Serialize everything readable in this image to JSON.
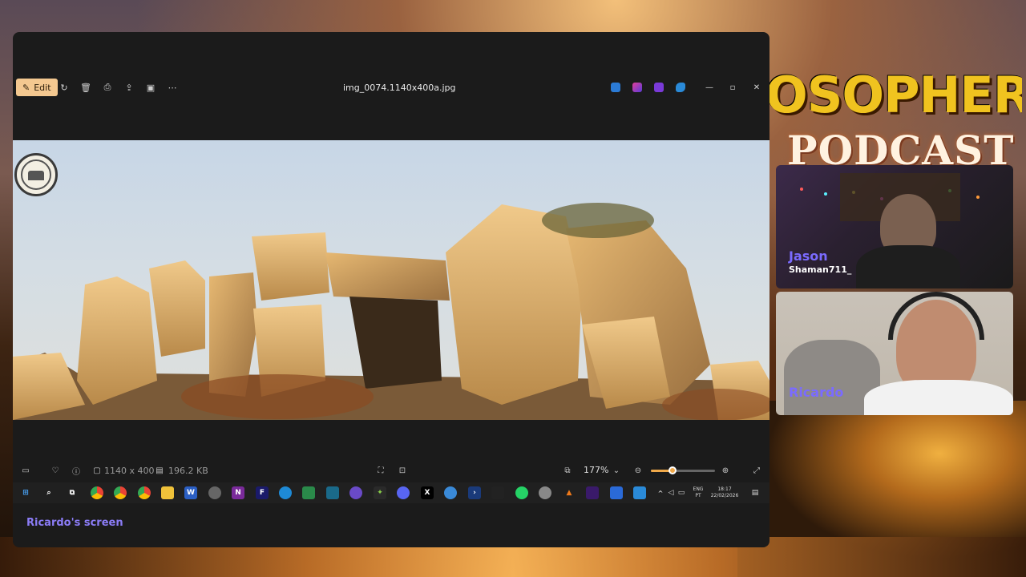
{
  "window": {
    "edit_label": "Edit",
    "file_name": "img_0074.1140x400a.jpg"
  },
  "info_bar": {
    "dimensions": "1140 x 400",
    "file_size": "196.2 KB",
    "zoom": "177%",
    "zoom_fraction": 0.34
  },
  "tray": {
    "lang_line1": "ENG",
    "lang_line2": "PT",
    "time": "18:17",
    "date": "22/02/2026"
  },
  "screen_label": "Ricardo's screen",
  "brand": {
    "title": "OSOPHER",
    "subtitle": "PODCAST"
  },
  "participants": [
    {
      "name": "Jason",
      "subtitle": "Shaman711_"
    },
    {
      "name": "Ricardo"
    }
  ],
  "colors": {
    "accent_edit": "#f4c890",
    "label_purple": "#8b7cf6",
    "zoom_accent": "#f0a94a"
  }
}
